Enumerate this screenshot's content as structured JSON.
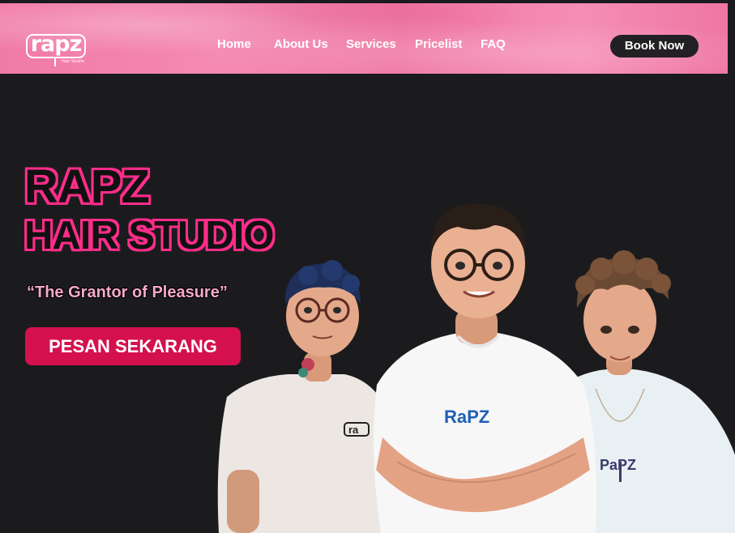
{
  "header": {
    "logo_text": "rapz",
    "logo_subtext": "Hair Studio",
    "nav": [
      {
        "label": "Home"
      },
      {
        "label": "About Us"
      },
      {
        "label": "Services"
      },
      {
        "label": "Pricelist"
      },
      {
        "label": "FAQ"
      }
    ],
    "book_button": "Book Now"
  },
  "hero": {
    "title_line1": "RAPZ",
    "title_line2": "HAIR STUDIO",
    "tagline": "“The Grantor of Pleasure”",
    "cta_button": "PESAN SEKARANG"
  },
  "shirts": {
    "left": "ra",
    "center": "RaPZ",
    "right": "PaPZ"
  },
  "colors": {
    "header_pink": "#f07aa6",
    "accent_pink": "#ff2d8a",
    "cta_red": "#d4104f",
    "background": "#1b1b1d",
    "book_button": "#222022"
  }
}
